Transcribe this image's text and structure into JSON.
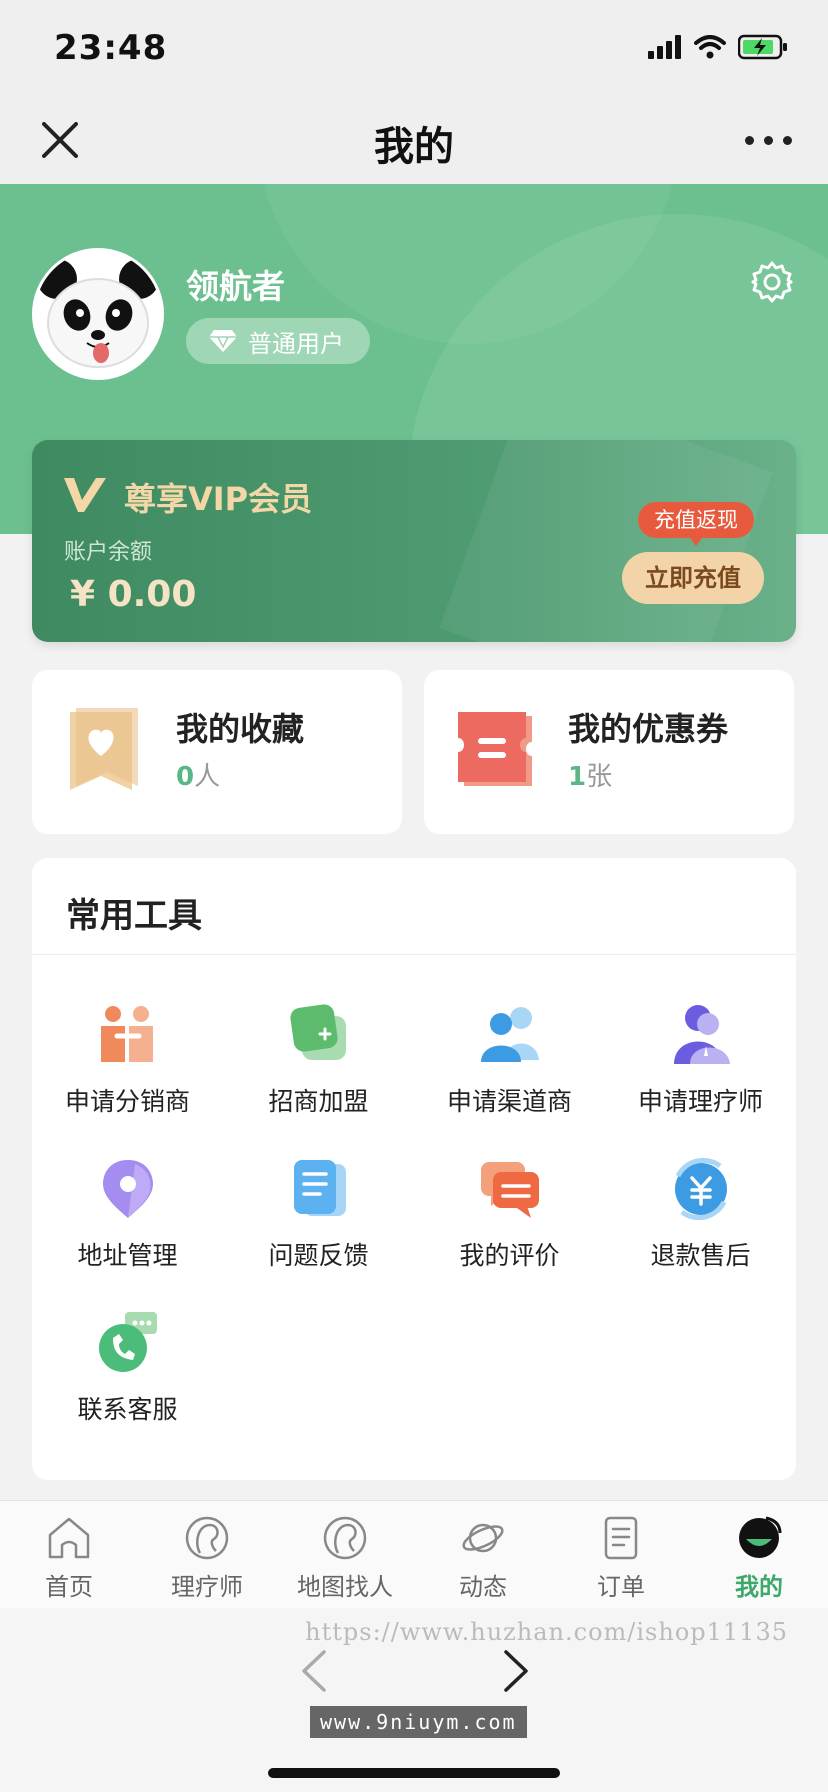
{
  "status": {
    "time": "23:48"
  },
  "nav": {
    "title": "我的"
  },
  "user": {
    "name": "领航者",
    "level": "普通用户"
  },
  "vip": {
    "title": "尊享VIP会员",
    "balance_label": "账户余额",
    "balance": "¥ 0.00",
    "promo": "充值返现",
    "recharge_label": "立即充值"
  },
  "favorites": {
    "title": "我的收藏",
    "count": "0",
    "unit": "人"
  },
  "coupons": {
    "title": "我的优惠券",
    "count": "1",
    "unit": "张"
  },
  "tools": {
    "title": "常用工具",
    "items": [
      {
        "label": "申请分销商",
        "icon": "distributor-icon"
      },
      {
        "label": "招商加盟",
        "icon": "franchise-icon"
      },
      {
        "label": "申请渠道商",
        "icon": "channel-partner-icon"
      },
      {
        "label": "申请理疗师",
        "icon": "therapist-icon"
      },
      {
        "label": "地址管理",
        "icon": "location-icon"
      },
      {
        "label": "问题反馈",
        "icon": "feedback-icon"
      },
      {
        "label": "我的评价",
        "icon": "reviews-icon"
      },
      {
        "label": "退款售后",
        "icon": "refund-icon"
      },
      {
        "label": "联系客服",
        "icon": "customer-service-icon"
      }
    ]
  },
  "tabbar": {
    "items": [
      {
        "label": "首页"
      },
      {
        "label": "理疗师"
      },
      {
        "label": "地图找人"
      },
      {
        "label": "动态"
      },
      {
        "label": "订单"
      },
      {
        "label": "我的"
      }
    ]
  },
  "browser": {
    "watermark_top": "https://www.huzhan.com/ishop11135",
    "watermark_bottom": "www.9niuym.com"
  },
  "colors": {
    "brand_green": "#6cc090",
    "active_tab": "#3ea86b",
    "vip_gold": "#f3d4a8"
  }
}
